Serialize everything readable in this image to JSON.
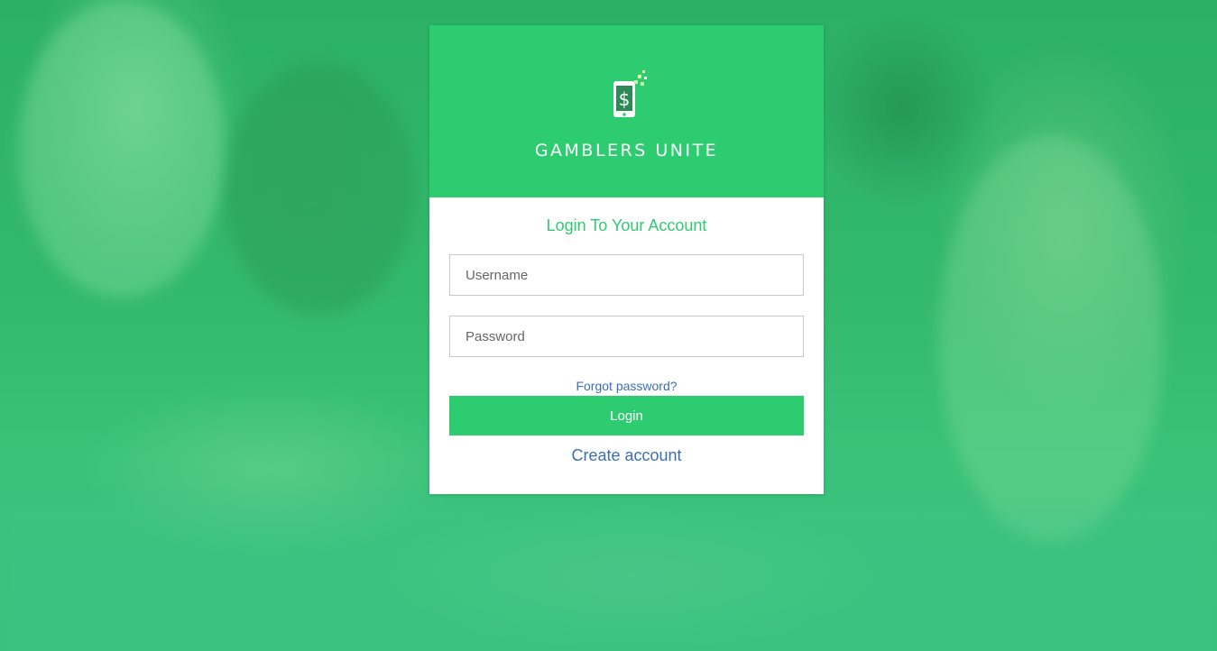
{
  "brand": {
    "name": "GAMBLERS UNITE",
    "logo_icon": "phone-dollar-icon",
    "logo_dollar": "$"
  },
  "login": {
    "title": "Login To Your Account",
    "username_placeholder": "Username",
    "password_placeholder": "Password",
    "forgot_label": "Forgot password?",
    "login_label": "Login",
    "create_label": "Create account"
  },
  "colors": {
    "accent": "#2ecc71",
    "link": "#3a6fb5"
  }
}
